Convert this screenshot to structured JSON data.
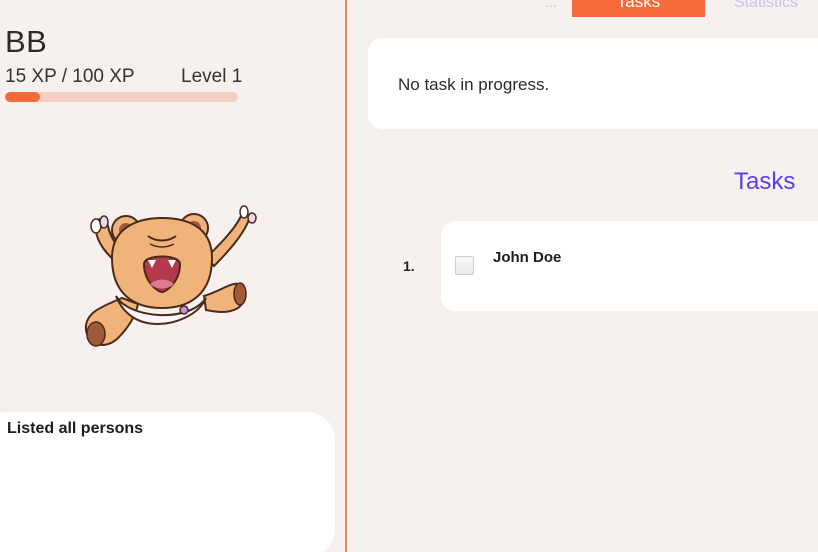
{
  "pet": {
    "name": "BB",
    "xp_text": "15 XP / 100 XP",
    "level_text": "Level 1",
    "xp_progress_fraction": 0.15,
    "figure": "angry-teddy-bear-in-diaper"
  },
  "result": {
    "message": "Listed all persons"
  },
  "tabs": {
    "ellipsis_label": "...",
    "tasks_label": "Tasks",
    "statistics_label": "Statistics"
  },
  "task_progress": {
    "message": "No task in progress."
  },
  "task_list": {
    "heading": "Tasks",
    "items": [
      {
        "index": "1.",
        "name": "John Doe",
        "checked": false
      }
    ]
  },
  "colors": {
    "accent_orange": "#f46a3a",
    "accent_purple": "#5a3df0",
    "background": "#f6f0ee",
    "card": "#ffffff",
    "xp_bar_track": "#f6cec2"
  }
}
